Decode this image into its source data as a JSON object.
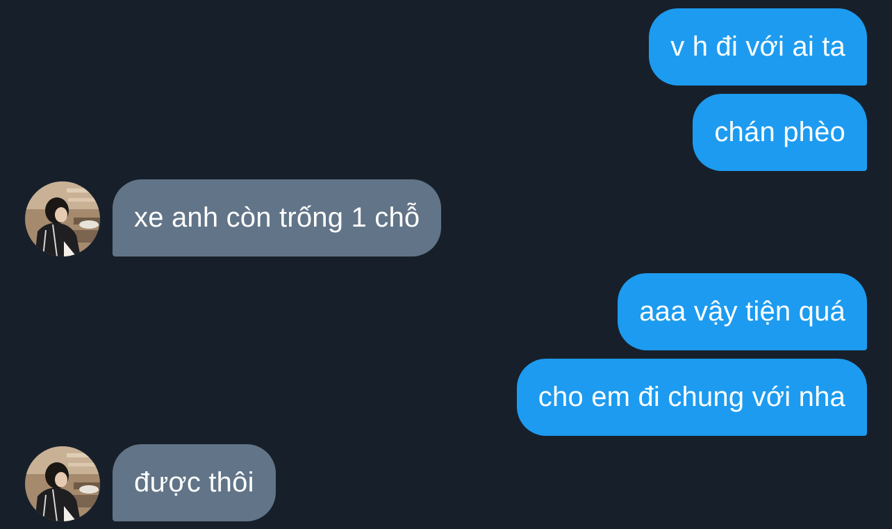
{
  "conversation": {
    "messages": [
      {
        "direction": "outgoing",
        "text": "v h đi với ai ta"
      },
      {
        "direction": "outgoing",
        "text": "chán phèo"
      },
      {
        "direction": "incoming",
        "text": "xe anh còn trống 1 chỗ",
        "avatar": "profile-photo"
      },
      {
        "direction": "outgoing",
        "text": "aaa vậy tiện quá"
      },
      {
        "direction": "outgoing",
        "text": "cho em đi chung với nha"
      },
      {
        "direction": "incoming",
        "text": "được thôi",
        "avatar": "profile-photo"
      }
    ]
  },
  "colors": {
    "background": "#17202a",
    "outgoing_bubble": "#1d9bf0",
    "incoming_bubble": "#627487",
    "text": "#ffffff"
  }
}
